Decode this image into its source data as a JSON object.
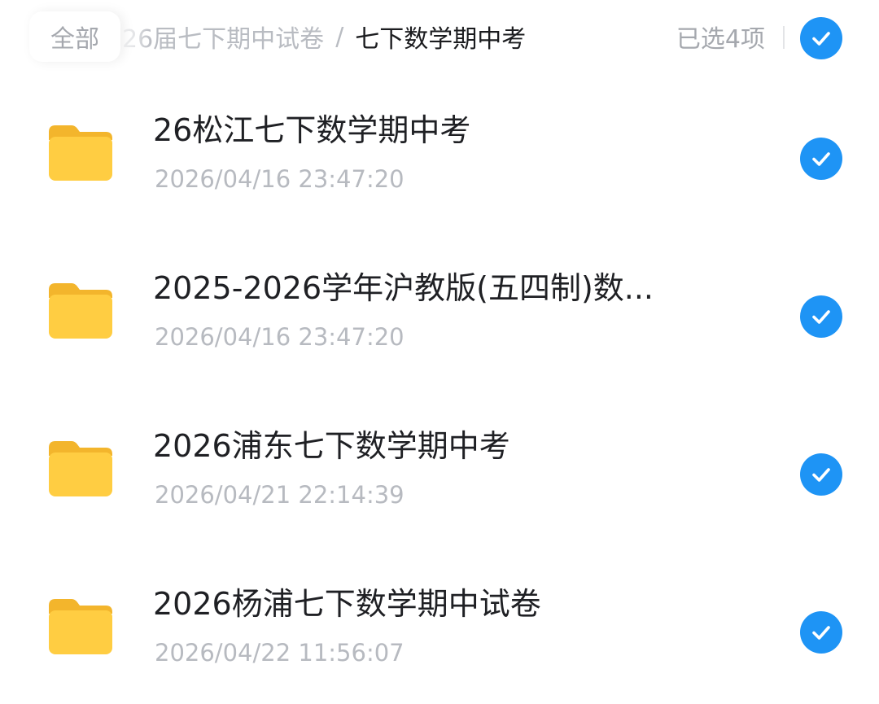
{
  "breadcrumb": {
    "all_label": "全部",
    "parent": "26届七下期中试卷",
    "separator": "/",
    "current": "七下数学期中考"
  },
  "selection": {
    "count_label": "已选4项",
    "select_all_checked": true
  },
  "colors": {
    "accent": "#1e94f5",
    "folder": "#ffc83a"
  },
  "files": [
    {
      "icon": "folder-icon",
      "name": "26松江七下数学期中考",
      "date": "2026/04/16 23:47:20",
      "checked": true
    },
    {
      "icon": "folder-icon",
      "name": "2025-2026学年沪教版(五四制)数...",
      "date": "2026/04/16 23:47:20",
      "checked": true
    },
    {
      "icon": "folder-icon",
      "name": "2026浦东七下数学期中考",
      "date": "2026/04/21 22:14:39",
      "checked": true
    },
    {
      "icon": "folder-icon",
      "name": "2026杨浦七下数学期中试卷",
      "date": "2026/04/22 11:56:07",
      "checked": true
    }
  ]
}
